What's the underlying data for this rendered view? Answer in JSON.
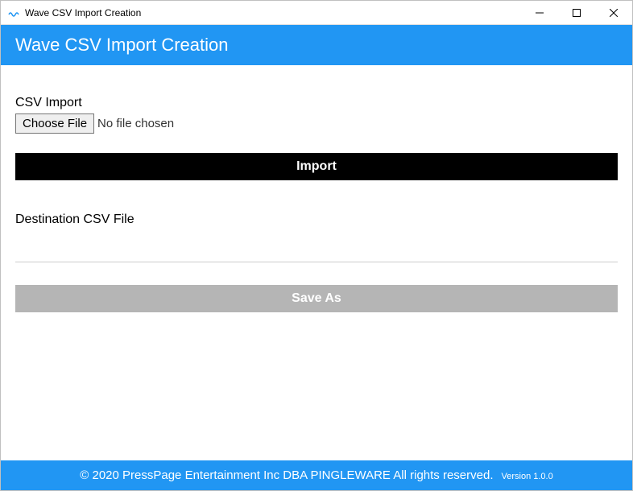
{
  "titlebar": {
    "title": "Wave CSV Import Creation"
  },
  "header": {
    "title": "Wave CSV Import Creation"
  },
  "csv_import": {
    "label": "CSV Import",
    "choose_file_label": "Choose File",
    "file_status": "No file chosen",
    "import_button": "Import"
  },
  "destination": {
    "label": "Destination CSV File",
    "value": "",
    "save_as_button": "Save As"
  },
  "footer": {
    "copyright": "© 2020 PressPage Entertainment Inc DBA PINGLEWARE  All rights reserved.",
    "version": "Version 1.0.0"
  }
}
